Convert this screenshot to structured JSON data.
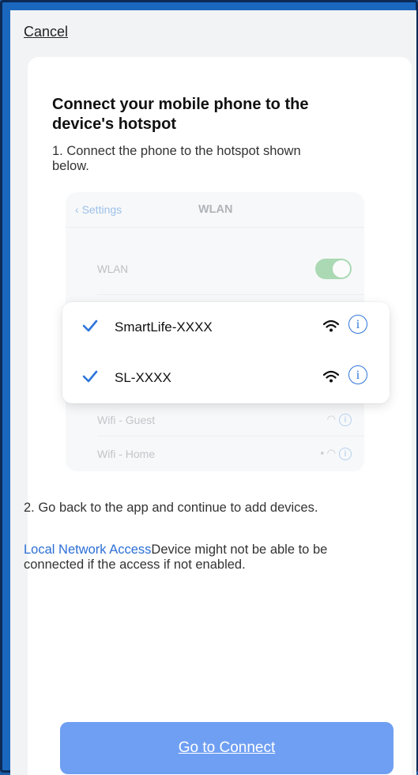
{
  "header": {
    "cancel_label": "Cancel"
  },
  "card": {
    "title": "Connect your mobile phone to the device's hotspot",
    "step1": "1. Connect the phone to the hotspot shown below.",
    "step2": "2. Go back to the app and continue to add devices.",
    "note_link": "Local Network Access",
    "note_text": "Device might not be able to be connected if the access if not enabled."
  },
  "ios_settings": {
    "back_label": "Settings",
    "header_title": "WLAN",
    "wlan_label": "WLAN",
    "wlan_enabled": true,
    "networks_bg": [
      {
        "ssid": "Wifi - Guest",
        "locked": false
      },
      {
        "ssid": "Wifi - Home",
        "locked": true
      }
    ]
  },
  "hotspots": [
    {
      "ssid": "SmartLife-XXXX",
      "checked": true
    },
    {
      "ssid": "SL-XXXX",
      "checked": true
    }
  ],
  "footer": {
    "connect_label": "Go to Connect"
  },
  "colors": {
    "accent": "#2c6fd6",
    "button": "#6f9ff2",
    "toggle": "#6cc07c"
  },
  "icons": {
    "check": "check-icon",
    "wifi": "wifi-icon",
    "info": "info-icon",
    "lock": "lock-icon",
    "back": "chevron-left-icon"
  }
}
